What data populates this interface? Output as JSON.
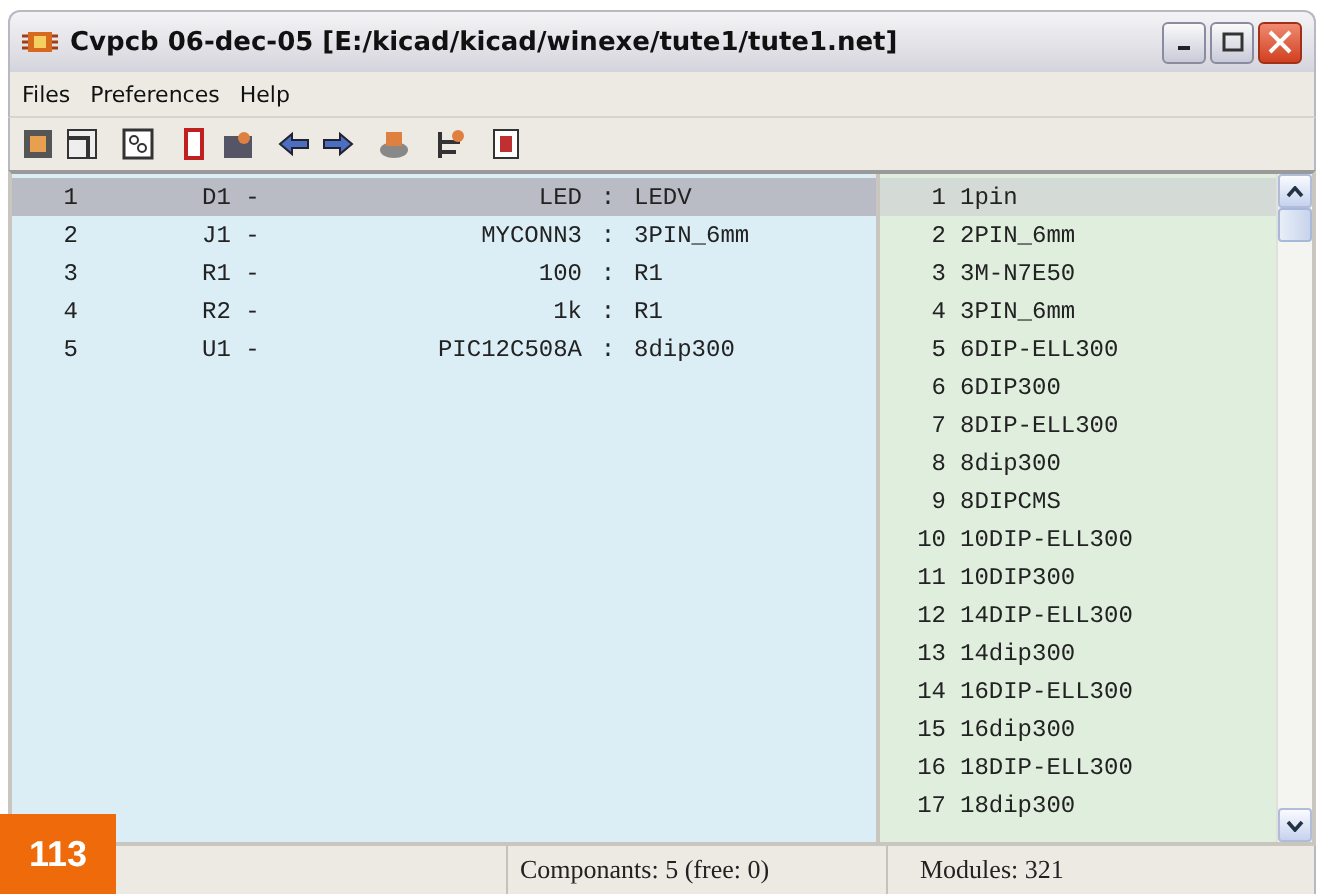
{
  "window": {
    "title": "Cvpcb 06-dec-05 [E:/kicad/kicad/winexe/tute1/tute1.net]"
  },
  "menu": [
    "Files",
    "Preferences",
    "Help"
  ],
  "components": [
    {
      "index": "1",
      "reference": "D1 -",
      "value": "LED",
      "footprint": "LEDV",
      "selected": true
    },
    {
      "index": "2",
      "reference": "J1 -",
      "value": "MYCONN3",
      "footprint": "3PIN_6mm",
      "selected": false
    },
    {
      "index": "3",
      "reference": "R1 -",
      "value": "100",
      "footprint": "R1",
      "selected": false
    },
    {
      "index": "4",
      "reference": "R2 -",
      "value": "1k",
      "footprint": "R1",
      "selected": false
    },
    {
      "index": "5",
      "reference": "U1 -",
      "value": "PIC12C508A",
      "footprint": "8dip300",
      "selected": false
    }
  ],
  "separator": ":",
  "modules": [
    {
      "index": "1",
      "name": "1pin",
      "selected": true
    },
    {
      "index": "2",
      "name": "2PIN_6mm",
      "selected": false
    },
    {
      "index": "3",
      "name": "3M-N7E50",
      "selected": false
    },
    {
      "index": "4",
      "name": "3PIN_6mm",
      "selected": false
    },
    {
      "index": "5",
      "name": "6DIP-ELL300",
      "selected": false
    },
    {
      "index": "6",
      "name": "6DIP300",
      "selected": false
    },
    {
      "index": "7",
      "name": "8DIP-ELL300",
      "selected": false
    },
    {
      "index": "8",
      "name": "8dip300",
      "selected": false
    },
    {
      "index": "9",
      "name": "8DIPCMS",
      "selected": false
    },
    {
      "index": "10",
      "name": "10DIP-ELL300",
      "selected": false
    },
    {
      "index": "11",
      "name": "10DIP300",
      "selected": false
    },
    {
      "index": "12",
      "name": "14DIP-ELL300",
      "selected": false
    },
    {
      "index": "13",
      "name": "14dip300",
      "selected": false
    },
    {
      "index": "14",
      "name": "16DIP-ELL300",
      "selected": false
    },
    {
      "index": "15",
      "name": "16dip300",
      "selected": false
    },
    {
      "index": "16",
      "name": "18DIP-ELL300",
      "selected": false
    },
    {
      "index": "17",
      "name": "18dip300",
      "selected": false
    }
  ],
  "status_bar": [
    "Componants: 5 (free: 0)",
    "Modules: 321"
  ],
  "figure_number": "113"
}
